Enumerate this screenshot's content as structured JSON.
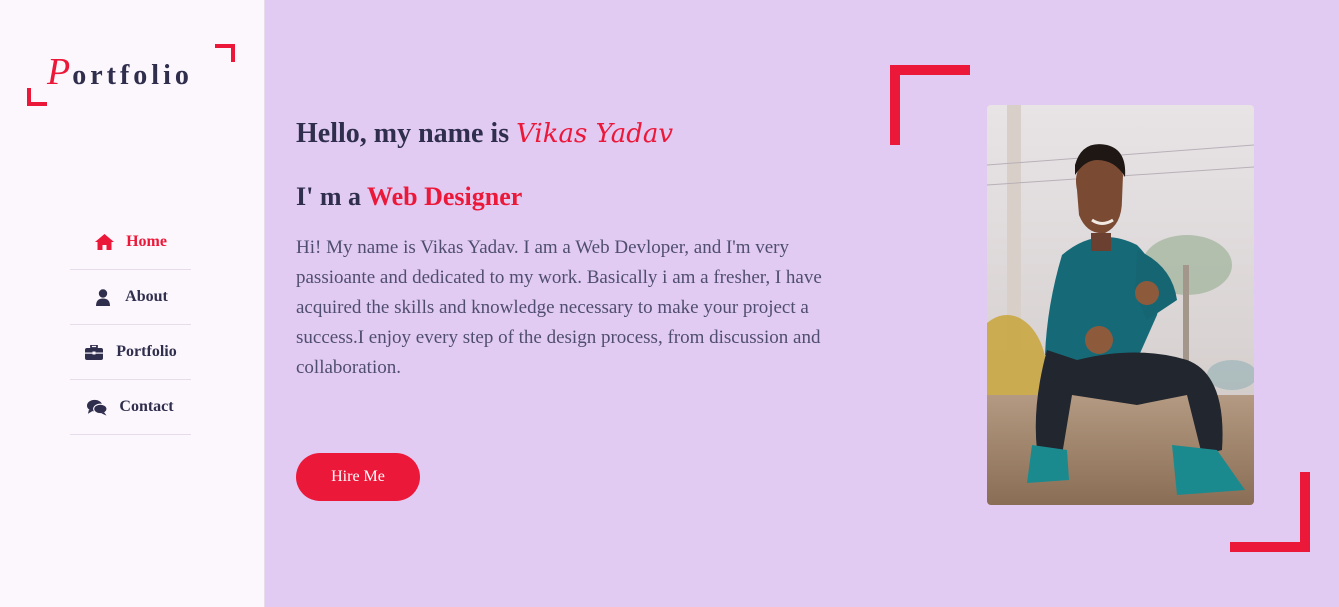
{
  "sidebar": {
    "logo": {
      "first_letter": "P",
      "rest": "ortfolio"
    },
    "nav": [
      {
        "label": "Home",
        "icon": "home-icon",
        "active": true
      },
      {
        "label": "About",
        "icon": "user-icon",
        "active": false
      },
      {
        "label": "Portfolio",
        "icon": "briefcase-icon",
        "active": false
      },
      {
        "label": "Contact",
        "icon": "comments-icon",
        "active": false
      }
    ]
  },
  "hero": {
    "greeting_prefix": "Hello, my name is ",
    "greeting_name": "Vikas Yadav",
    "role_prefix": "I' m a ",
    "role_title": "Web Designer",
    "description": "Hi! My name is Vikas Yadav. I am a Web Devloper, and I'm very passioante and dedicated to my work. Basically i am a fresher, I have acquired the skills and knowledge necessary to make your project a success.I enjoy every step of the design process, from discussion and collaboration.",
    "button_label": "Hire Me",
    "photo": "profile-photo"
  },
  "colors": {
    "accent": "#ec1839",
    "sidebar_bg": "#fcf7fd",
    "main_bg": "#e1cbf3",
    "text_dark": "#302e4d",
    "text_body": "#504e70"
  }
}
